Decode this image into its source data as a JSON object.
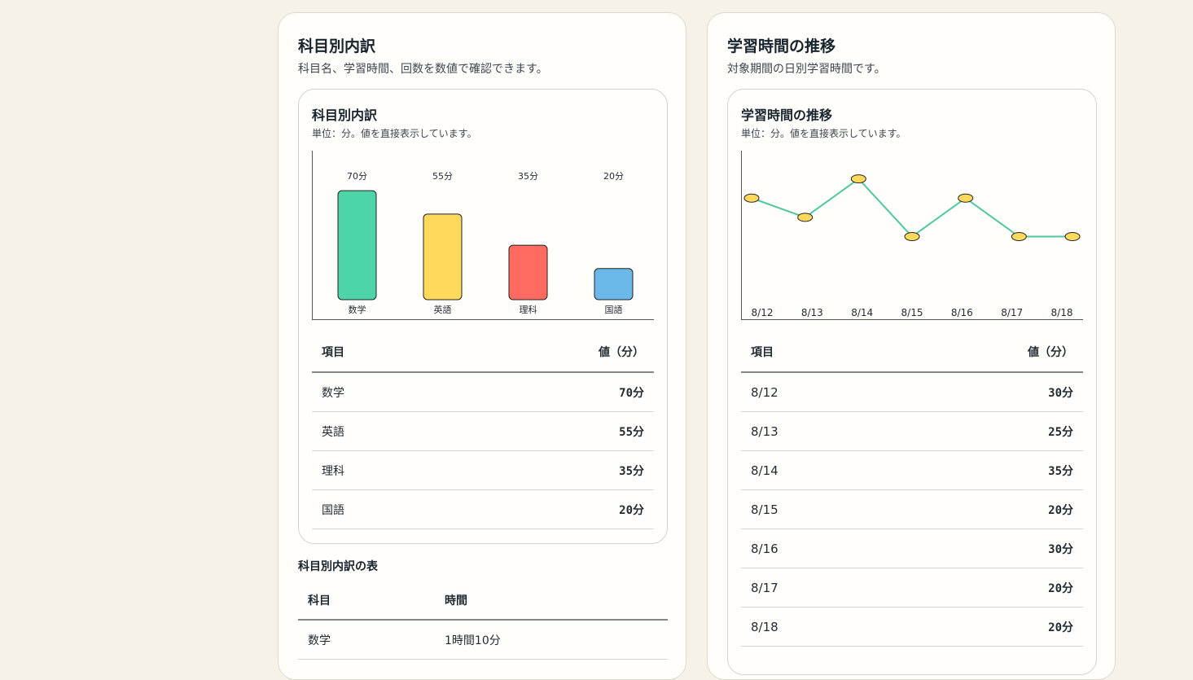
{
  "breakdown": {
    "title": "科目別内訳",
    "subtitle": "科目名、学習時間、回数を数値で確認できます。",
    "inner_title": "科目別内訳",
    "inner_subtitle": "単位：分。値を直接表示しています。",
    "table_headers": {
      "item": "項目",
      "value": "値（分）"
    },
    "rows": [
      {
        "label": "数学",
        "value": "70分"
      },
      {
        "label": "英語",
        "value": "55分"
      },
      {
        "label": "理科",
        "value": "35分"
      },
      {
        "label": "国語",
        "value": "20分"
      }
    ],
    "summary_title": "科目別内訳の表",
    "summary_headers": {
      "subject": "科目",
      "time": "時間"
    },
    "summary_rows": [
      {
        "subject": "数学",
        "time": "1時間10分"
      }
    ]
  },
  "trend": {
    "title": "学習時間の推移",
    "subtitle": "対象期間の日別学習時間です。",
    "inner_title": "学習時間の推移",
    "inner_subtitle": "単位：分。値を直接表示しています。",
    "table_headers": {
      "item": "項目",
      "value": "値（分）"
    },
    "rows": [
      {
        "label": "8/12",
        "value": "30分"
      },
      {
        "label": "8/13",
        "value": "25分"
      },
      {
        "label": "8/14",
        "value": "35分"
      },
      {
        "label": "8/15",
        "value": "20分"
      },
      {
        "label": "8/16",
        "value": "30分"
      },
      {
        "label": "8/17",
        "value": "20分"
      },
      {
        "label": "8/18",
        "value": "20分"
      }
    ]
  },
  "chart_data": [
    {
      "type": "bar",
      "categories": [
        "数学",
        "英語",
        "理科",
        "国語"
      ],
      "values": [
        70,
        55,
        35,
        20
      ],
      "value_labels": [
        "70分",
        "55分",
        "35分",
        "20分"
      ],
      "colors": [
        "#4dd4a8",
        "#ffd95c",
        "#ff6b61",
        "#6cb8e8"
      ],
      "ylim": [
        0,
        80
      ],
      "grid": false
    },
    {
      "type": "line",
      "x": [
        "8/12",
        "8/13",
        "8/14",
        "8/15",
        "8/16",
        "8/17",
        "8/18"
      ],
      "values": [
        30,
        25,
        35,
        20,
        30,
        20,
        20
      ],
      "line_color": "#4cc9a0",
      "marker_color": "#ffd95c",
      "ylim": [
        0,
        40
      ],
      "grid": false
    }
  ]
}
